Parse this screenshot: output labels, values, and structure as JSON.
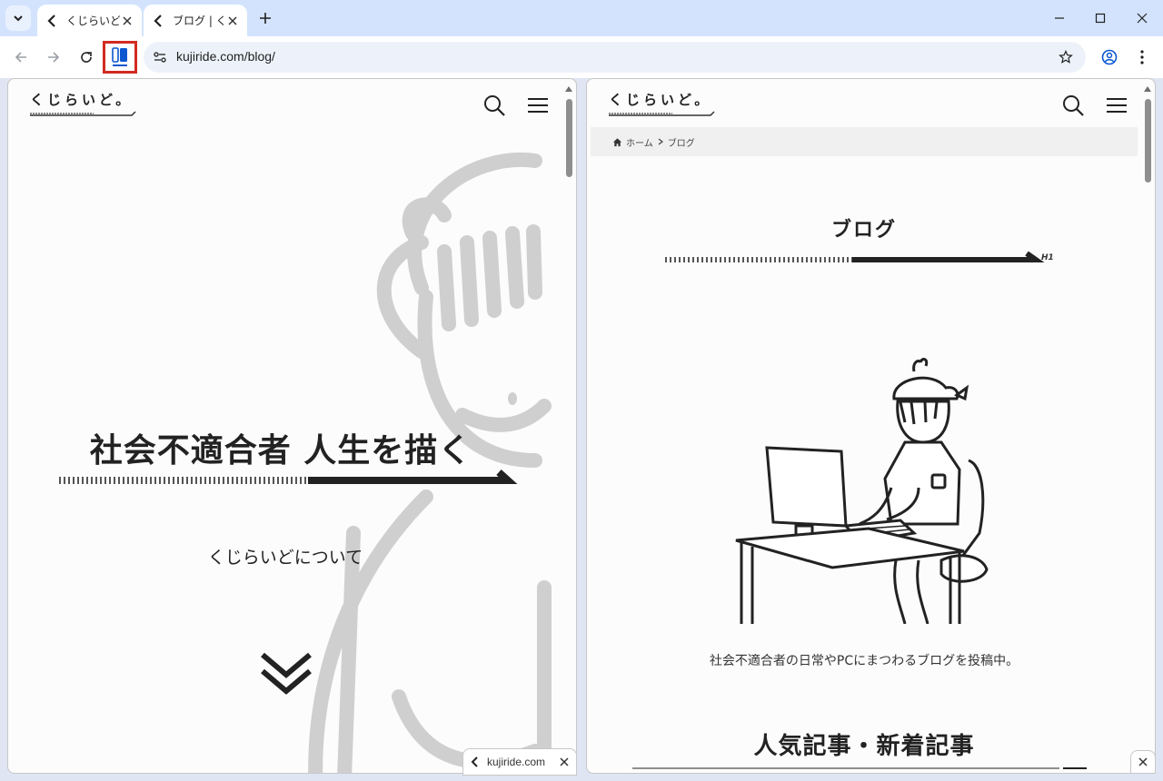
{
  "tabs": [
    {
      "title": "くじらいど |",
      "active": true
    },
    {
      "title": "ブログ | くじ",
      "active": true
    }
  ],
  "toolbar": {
    "url": "kujiride.com/blog/"
  },
  "left_pane": {
    "logo": "くじらいど。",
    "hero_title": "社会不適合者 人生を描く",
    "hero_link": "くじらいどについて"
  },
  "right_pane": {
    "logo": "くじらいど。",
    "breadcrumb": [
      "ホーム",
      "ブログ"
    ],
    "page_title": "ブログ",
    "h1_tag": "H1",
    "description": "社会不適合者の日常やPCにまつわるブログを投稿中。",
    "section_title": "人気記事・新着記事"
  },
  "popup": {
    "title": "kujiride.com"
  },
  "colors": {
    "tabstrip": "#d3e3fd",
    "accent_red": "#d22a22",
    "split_blue": "#0b57d0"
  }
}
